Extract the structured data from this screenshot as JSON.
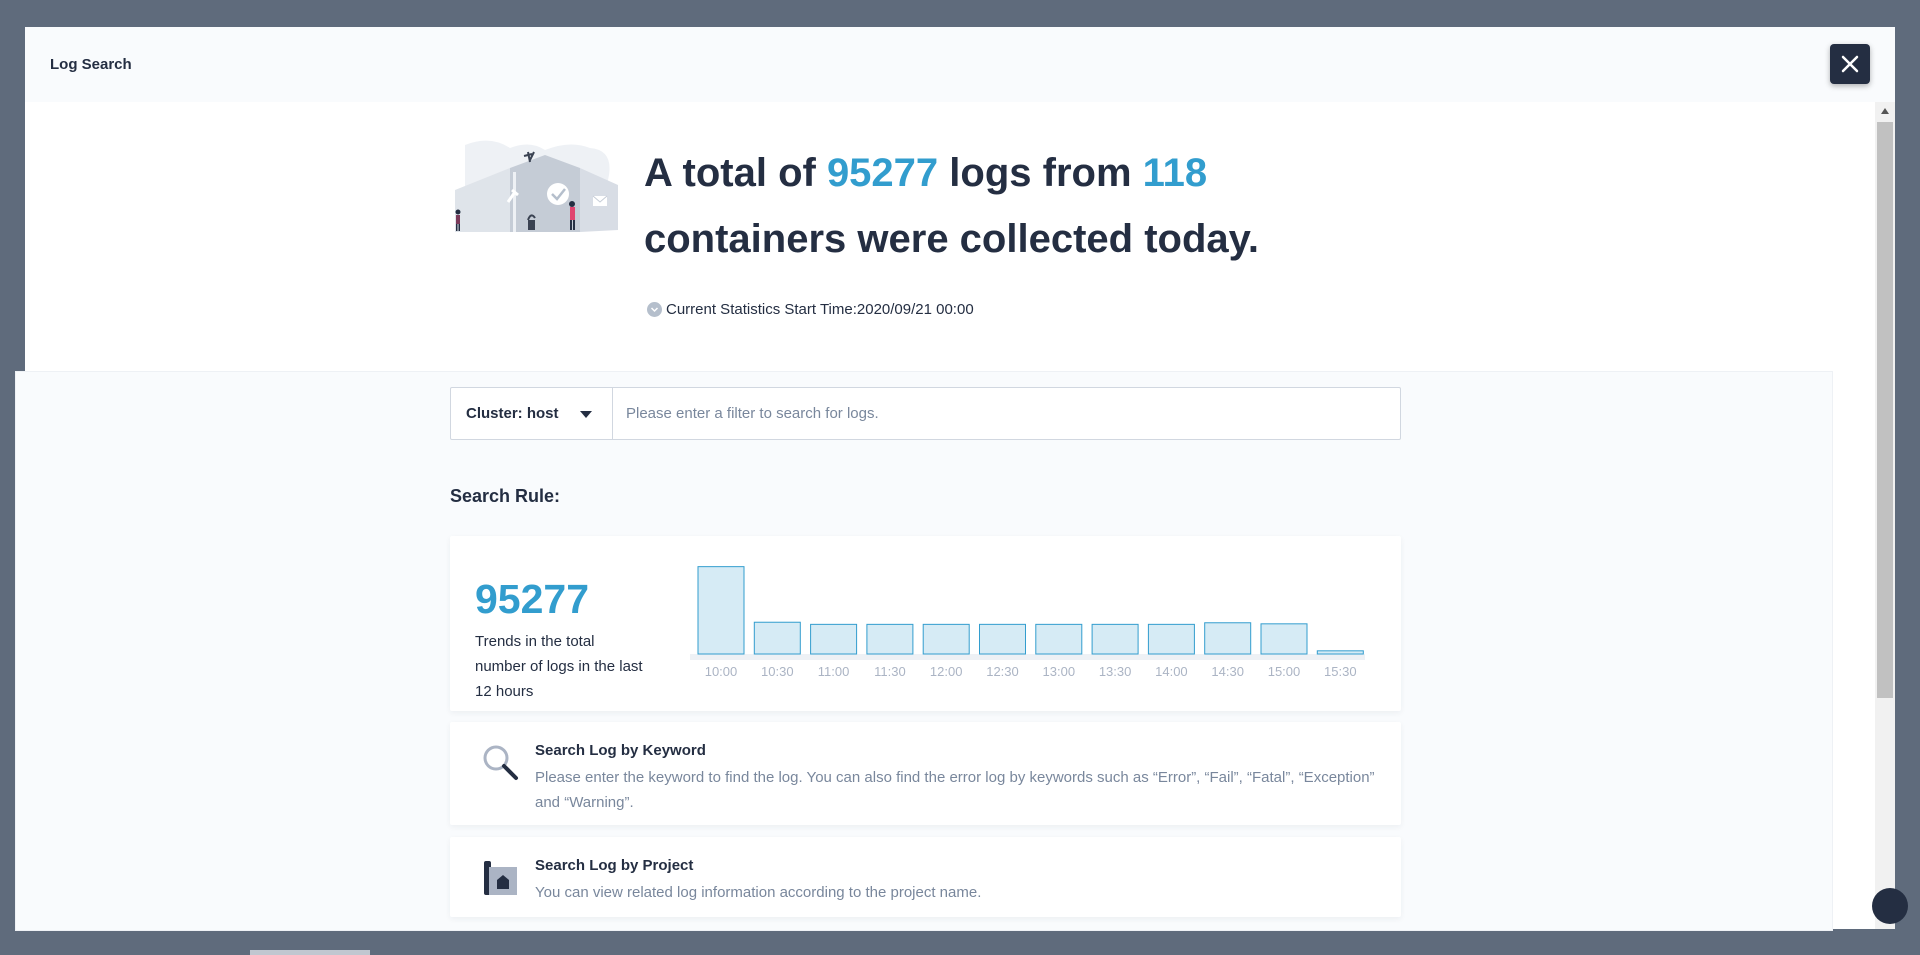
{
  "modal": {
    "title": "Log Search"
  },
  "hero": {
    "prefix": "A total of ",
    "log_count": "95277",
    "middle": " logs from ",
    "container_count": "118",
    "suffix": "containers were collected today.",
    "start_time": "Current Statistics Start Time:2020/09/21 00:00"
  },
  "search": {
    "cluster_label": "Cluster: host",
    "placeholder": "Please enter a filter to search for logs."
  },
  "rules": {
    "heading": "Search Rule:",
    "items": [
      {
        "title": "Search Log by Keyword",
        "description": "Please enter the keyword to find the log. You can also find the error log by keywords such as “Error”, “Fail”, “Fatal”, “Exception” and “Warning”.",
        "icon": "magnifier-icon"
      },
      {
        "title": "Search Log by Project",
        "description": "You can view related log information according to the project name.",
        "icon": "project-icon"
      }
    ]
  },
  "trend": {
    "total": "95277",
    "caption": "Trends in the total number of logs in the last 12 hours"
  },
  "chart_data": {
    "type": "bar",
    "categories": [
      "10:00",
      "10:30",
      "11:00",
      "11:30",
      "12:00",
      "12:30",
      "13:00",
      "13:30",
      "14:00",
      "14:30",
      "15:00",
      "15:30"
    ],
    "values": [
      16500,
      6000,
      5600,
      5600,
      5600,
      5600,
      5600,
      5600,
      5600,
      5900,
      5700,
      600
    ],
    "title": "",
    "xlabel": "",
    "ylabel": "",
    "ylim": [
      0,
      17000
    ],
    "grid": false,
    "colors": {
      "fill": "#d6ebf5",
      "stroke": "#329dce",
      "axis": "#eef1f5",
      "tick": "#abb4c4"
    }
  },
  "colors": {
    "accent": "#329dce",
    "text": "#242e42",
    "muted": "#79879c",
    "overlay": "#5f6b7c"
  },
  "icons": {
    "close": "close-icon",
    "clock": "clock-icon",
    "caret": "caret-down-icon"
  }
}
